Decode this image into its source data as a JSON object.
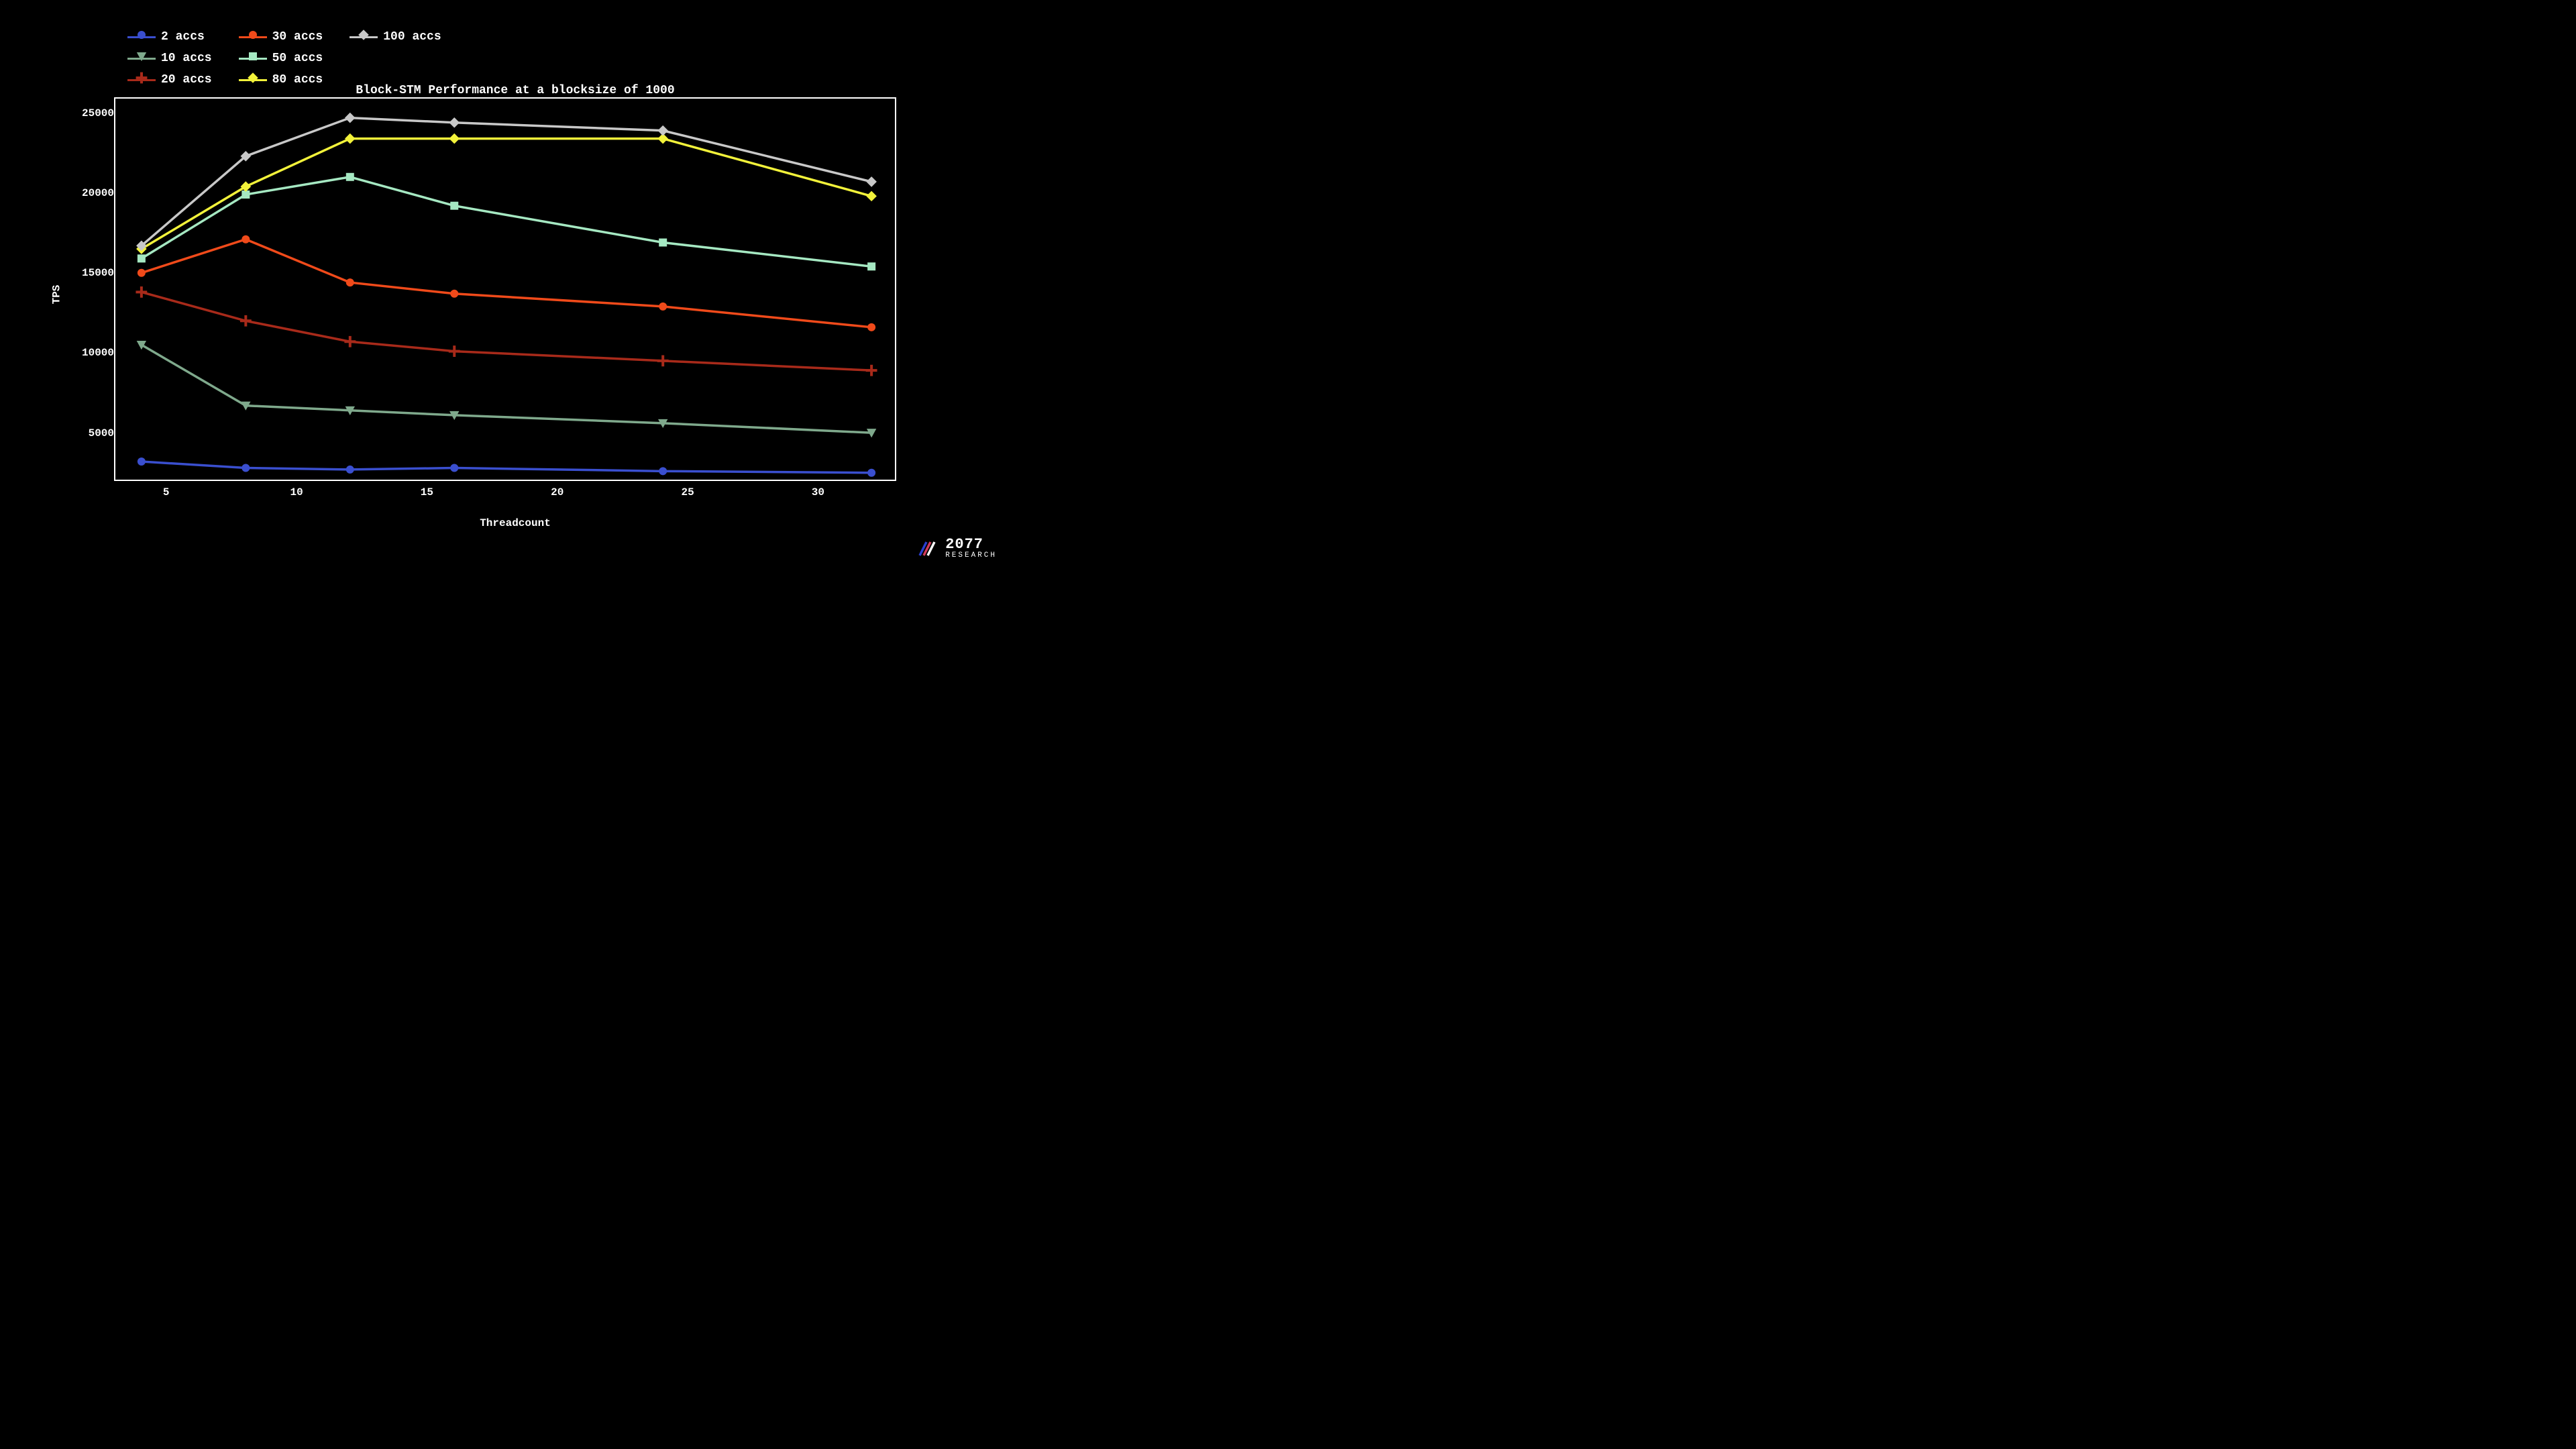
{
  "chart_data": {
    "type": "line",
    "title": "Block-STM Performance at a blocksize of 1000",
    "xlabel": "Threadcount",
    "ylabel": "TPS",
    "x": [
      4,
      8,
      12,
      16,
      24,
      32
    ],
    "x_ticks": [
      5,
      10,
      15,
      20,
      25,
      30
    ],
    "y_ticks": [
      5000,
      10000,
      15000,
      20000,
      25000
    ],
    "xlim": [
      3,
      33
    ],
    "ylim": [
      2000,
      26000
    ],
    "series": [
      {
        "name": "2 accs",
        "color": "#3a4fcf",
        "marker": "circle",
        "values": [
          3300,
          2900,
          2800,
          2900,
          2700,
          2600
        ]
      },
      {
        "name": "10 accs",
        "color": "#7fa98c",
        "marker": "triangle-down",
        "values": [
          10600,
          6800,
          6500,
          6200,
          5700,
          5100
        ]
      },
      {
        "name": "20 accs",
        "color": "#a82a1a",
        "marker": "plus",
        "values": [
          13900,
          12100,
          10800,
          10200,
          9600,
          9000
        ]
      },
      {
        "name": "30 accs",
        "color": "#f04a1a",
        "marker": "circle",
        "values": [
          15100,
          17200,
          14500,
          13800,
          13000,
          11700
        ]
      },
      {
        "name": "50 accs",
        "color": "#a5e8c2",
        "marker": "square",
        "values": [
          16000,
          20000,
          21100,
          19300,
          17000,
          15500
        ]
      },
      {
        "name": "80 accs",
        "color": "#f2f23a",
        "marker": "diamond",
        "values": [
          16600,
          20500,
          23500,
          23500,
          23500,
          19900
        ]
      },
      {
        "name": "100 accs",
        "color": "#c8c8c8",
        "marker": "diamond",
        "values": [
          16800,
          22400,
          24800,
          24500,
          24000,
          20800
        ]
      }
    ]
  },
  "brand": {
    "year": "2077",
    "sub": "RESEARCH"
  }
}
